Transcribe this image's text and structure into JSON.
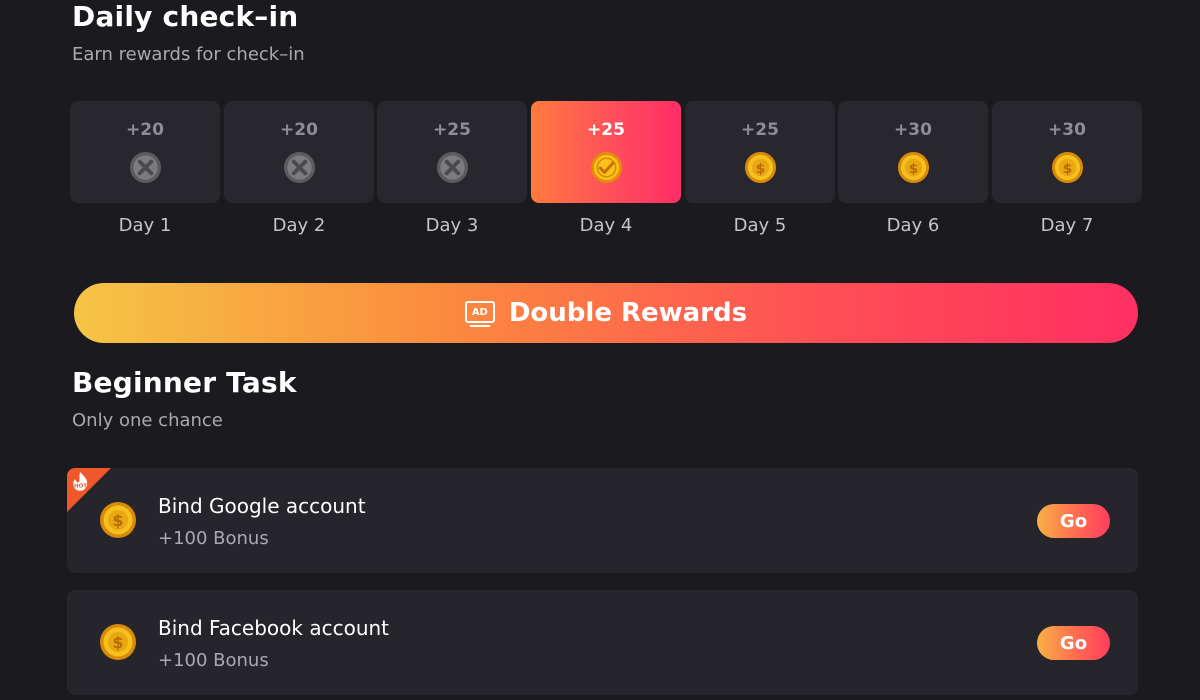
{
  "checkin": {
    "title": "Daily check–in",
    "subtitle": "Earn rewards for check–in",
    "days": [
      {
        "amount": "+20",
        "label": "Day 1",
        "state": "missed"
      },
      {
        "amount": "+20",
        "label": "Day 2",
        "state": "missed"
      },
      {
        "amount": "+25",
        "label": "Day 3",
        "state": "missed"
      },
      {
        "amount": "+25",
        "label": "Day 4",
        "state": "checked"
      },
      {
        "amount": "+25",
        "label": "Day 5",
        "state": "upcoming"
      },
      {
        "amount": "+30",
        "label": "Day 6",
        "state": "upcoming"
      },
      {
        "amount": "+30",
        "label": "Day 7",
        "state": "upcoming"
      }
    ],
    "double_button": {
      "label": "Double Rewards",
      "ad_badge": "AD"
    }
  },
  "beginner": {
    "title": "Beginner Task",
    "subtitle": "Only one chance",
    "tasks": [
      {
        "title": "Bind Google account",
        "bonus": "+100 Bonus",
        "button": "Go",
        "hot": true,
        "hot_label": "HOT"
      },
      {
        "title": "Bind Facebook account",
        "bonus": "+100 Bonus",
        "button": "Go",
        "hot": false
      }
    ]
  },
  "colors": {
    "background": "#1b1b1f",
    "card": "#27272d",
    "accent_orange": "#ff7a3c",
    "accent_pink": "#ff2d66",
    "coin_gold": "#f2b516",
    "missed_gray": "#6e6e72"
  },
  "icons": {
    "missed": "crossed-coin-icon",
    "checked": "check-coin-icon",
    "upcoming": "dollar-coin-icon",
    "ad": "ad-icon",
    "hot": "hot-flame-icon"
  }
}
